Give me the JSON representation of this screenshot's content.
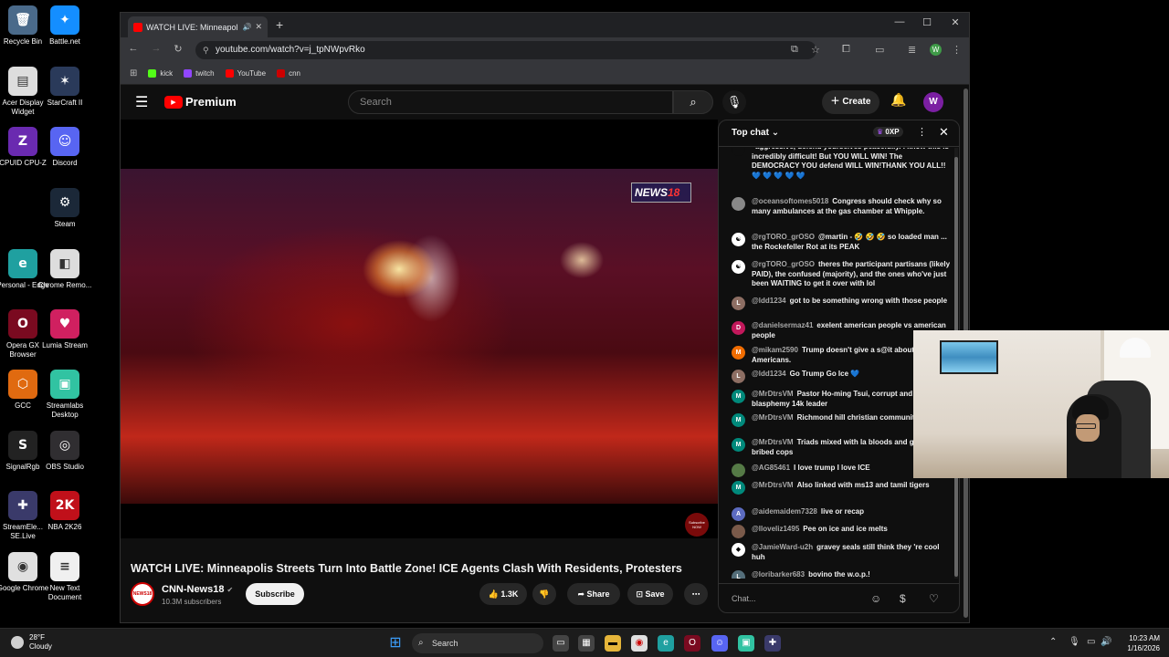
{
  "desktop": {
    "icons": [
      {
        "label": "Recycle Bin",
        "icon": "recycle-bin-icon",
        "glyph": "🗑",
        "color": "#4a6a8a"
      },
      {
        "label": "Battle.net",
        "icon": "battlenet-icon",
        "glyph": "✦",
        "color": "#148eff"
      },
      {
        "label": "Acer Display Widget",
        "icon": "acer-display-icon",
        "glyph": "▤",
        "color": "#dddddd"
      },
      {
        "label": "StarCraft II",
        "icon": "starcraft-icon",
        "glyph": "✶",
        "color": "#2a3a5a"
      },
      {
        "label": "CPUID CPU-Z",
        "icon": "cpuz-icon",
        "glyph": "Z",
        "color": "#6a2ab0"
      },
      {
        "label": "Discord",
        "icon": "discord-icon",
        "glyph": "☺",
        "color": "#5865f2"
      },
      {
        "label": "Steam",
        "icon": "steam-icon",
        "glyph": "⚙",
        "color": "#1b2838"
      },
      {
        "label": "Personal - Edge",
        "icon": "edge-icon",
        "glyph": "e",
        "color": "#1fa0a0"
      },
      {
        "label": "Chrome Remo...",
        "icon": "chrome-remote-icon",
        "glyph": "◧",
        "color": "#dddddd"
      },
      {
        "label": "Opera GX Browser",
        "icon": "opera-gx-icon",
        "glyph": "O",
        "color": "#7a0a20"
      },
      {
        "label": "Lumia Stream",
        "icon": "lumia-stream-icon",
        "glyph": "♥",
        "color": "#d02060"
      },
      {
        "label": "GCC",
        "icon": "gcc-icon",
        "glyph": "⬡",
        "color": "#e06a10"
      },
      {
        "label": "Streamlabs Desktop",
        "icon": "streamlabs-icon",
        "glyph": "▣",
        "color": "#31c3a2"
      },
      {
        "label": "SignalRgb",
        "icon": "signalrgb-icon",
        "glyph": "S",
        "color": "#222222"
      },
      {
        "label": "OBS Studio",
        "icon": "obs-studio-icon",
        "glyph": "◎",
        "color": "#302e31"
      },
      {
        "label": "StreamEle... SE.Live",
        "icon": "streamelements-icon",
        "glyph": "✚",
        "color": "#3a3a6a"
      },
      {
        "label": "NBA 2K26",
        "icon": "nba2k26-icon",
        "glyph": "2K",
        "color": "#c0101a"
      },
      {
        "label": "Google Chrome",
        "icon": "chrome-icon",
        "glyph": "◉",
        "color": "#e0e0e0"
      },
      {
        "label": "New Text Document",
        "icon": "text-document-icon",
        "glyph": "≡",
        "color": "#f0f0f0"
      }
    ]
  },
  "browser": {
    "tab_title": "WATCH LIVE: Minneapolis S",
    "url": "youtube.com/watch?v=j_tpNWpvRko",
    "bookmarks": [
      {
        "label": "kick",
        "color": "#53fc18"
      },
      {
        "label": "twitch",
        "color": "#9146ff"
      },
      {
        "label": "YouTube",
        "color": "#ff0000"
      },
      {
        "label": "cnn",
        "color": "#cc0000"
      }
    ],
    "profile_initial": "W"
  },
  "youtube": {
    "logo_text": "Premium",
    "search_placeholder": "Search",
    "create_label": "Create",
    "avatar_initial": "W",
    "video": {
      "overlay_logo": "NEWS",
      "overlay_logo_num": "18",
      "subscribe_badge": "Subscribe NOW",
      "title": "WATCH LIVE: Minneapolis Streets Turn Into Battle Zone! ICE Agents Clash With Residents, Protesters"
    },
    "channel": {
      "name": "CNN-News18",
      "subscribers": "10.3M subscribers",
      "avatar_text": "NEWS18",
      "subscribe_label": "Subscribe"
    },
    "actions": {
      "likes": "1.3K",
      "share_label": "Share",
      "save_label": "Save"
    }
  },
  "chat": {
    "header": "Top chat",
    "xp": "0XP",
    "input_placeholder": "Chat...",
    "messages": [
      {
        "author": "",
        "text": "aggressive, defend yourselves peacefully. I know this is incredibly difficult! But YOU WILL WIN! The DEMOCRACY YOU defend WILL WIN!THANK YOU ALL!! 💙 💙 💙 💙 💙",
        "initial": "",
        "color": "#0f0f0f"
      },
      {
        "author": "@oceansoftomes5018",
        "text": "Congress should check why so many ambulances at the gas chamber at Whipple.",
        "initial": "",
        "color": "#888888"
      },
      {
        "author": "@rgTORO_grOSO",
        "text": "@martin - 🤣 🤣 🤣 so loaded man ... the Rockefeller Rot at its PEAK",
        "initial": "☯",
        "color": "#ffffff"
      },
      {
        "author": "@rgTORO_grOSO",
        "text": "theres the participant partisans (likely PAID), the confused (majority), and the ones who've just been WAITING to get it over with lol",
        "initial": "☯",
        "color": "#ffffff"
      },
      {
        "author": "@ldd1234",
        "text": "got to be something wrong with those people",
        "initial": "L",
        "color": "#8d6e63"
      },
      {
        "author": "@danielsermaz41",
        "text": "exelent american people vs american people",
        "initial": "D",
        "color": "#c2185b"
      },
      {
        "author": "@mikam2590",
        "text": "Trump doesn't give a s@it about average Americans.",
        "initial": "M",
        "color": "#ef6c00"
      },
      {
        "author": "@ldd1234",
        "text": "Go Trump Go Ice 💙",
        "initial": "L",
        "color": "#8d6e63"
      },
      {
        "author": "@MrDtrsVM",
        "text": "Pastor Ho-ming Tsui, corrupt and blasphemy 14k leader",
        "initial": "M",
        "color": "#00897b"
      },
      {
        "author": "@MrDtrsVM",
        "text": "Richmond hill christian community church",
        "initial": "M",
        "color": "#00897b"
      },
      {
        "author": "@MrDtrsVM",
        "text": "Triads mixed with la bloods and gangs and bribed cops",
        "initial": "M",
        "color": "#00897b"
      },
      {
        "author": "@AG85461",
        "text": "I love trump I love ICE",
        "initial": "",
        "color": "#557a46"
      },
      {
        "author": "@MrDtrsVM",
        "text": "Also linked with ms13 and tamil tigers",
        "initial": "M",
        "color": "#00897b"
      },
      {
        "author": "@aidemaidem7328",
        "text": "live or recap",
        "initial": "A",
        "color": "#5c6bc0"
      },
      {
        "author": "@lloveliz1495",
        "text": "Pee on ice and ice melts",
        "initial": "",
        "color": "#7a5a4a"
      },
      {
        "author": "@JamieWard-u2h",
        "text": "gravey seals still think they 're cool huh",
        "initial": "◆",
        "color": "#ffffff"
      },
      {
        "author": "@loribarker683",
        "text": "bovino the w.o.p.!",
        "initial": "L",
        "color": "#546e7a"
      }
    ]
  },
  "taskbar": {
    "weather_temp": "28°F",
    "weather_desc": "Cloudy",
    "search_label": "Search",
    "time": "10:23 AM",
    "date": "1/16/2026"
  }
}
